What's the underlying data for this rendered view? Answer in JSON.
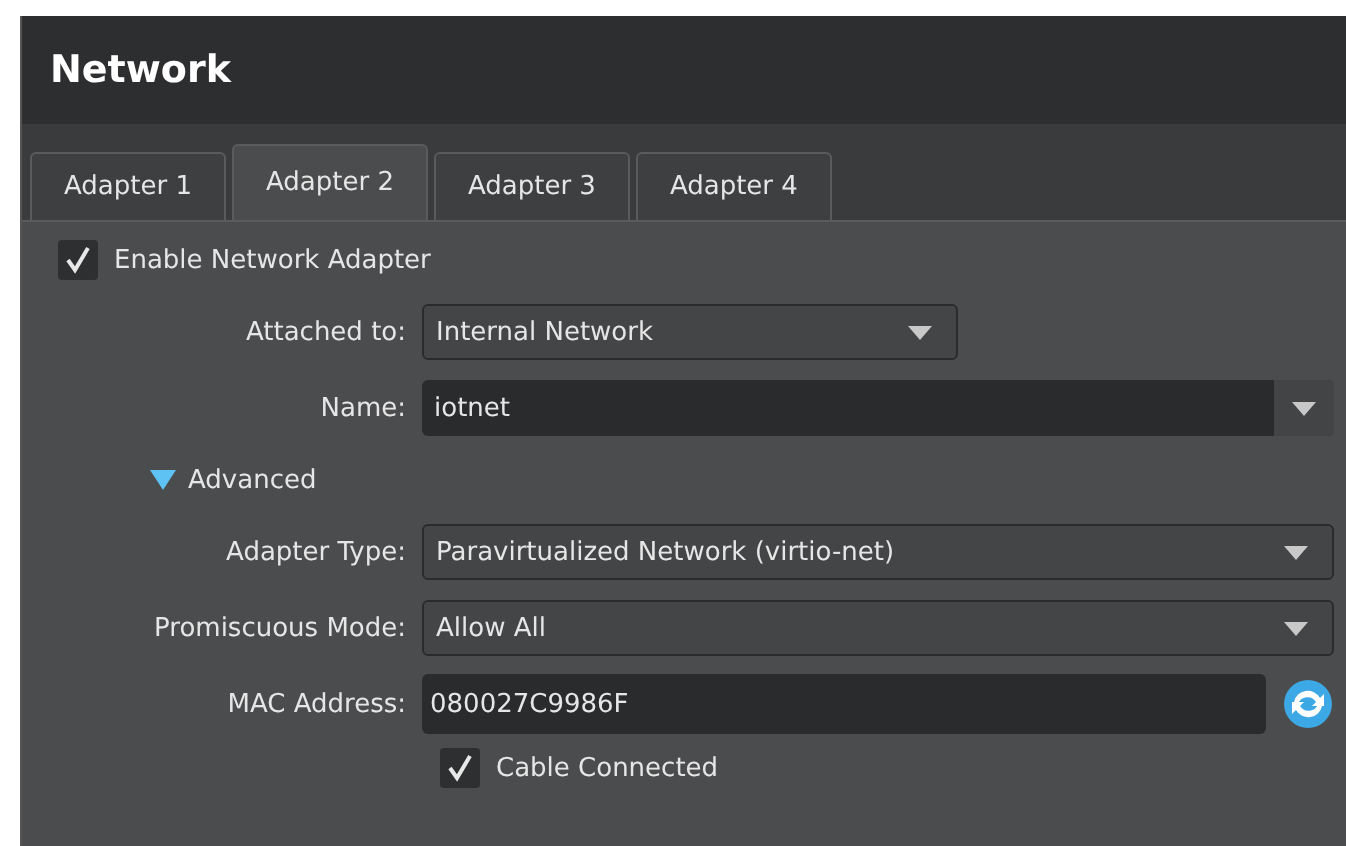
{
  "window": {
    "title": "Network"
  },
  "tabs": [
    {
      "label": "Adapter 1",
      "selected": false
    },
    {
      "label": "Adapter 2",
      "selected": true
    },
    {
      "label": "Adapter 3",
      "selected": false
    },
    {
      "label": "Adapter 4",
      "selected": false
    }
  ],
  "enable_adapter": {
    "label": "Enable Network Adapter",
    "checked": true
  },
  "attached_to": {
    "label": "Attached to:",
    "value": "Internal Network"
  },
  "name": {
    "label": "Name:",
    "value": "iotnet"
  },
  "advanced": {
    "label": "Advanced",
    "expanded": true
  },
  "adapter_type": {
    "label": "Adapter Type:",
    "value": "Paravirtualized Network (virtio-net)"
  },
  "promiscuous_mode": {
    "label": "Promiscuous Mode:",
    "value": "Allow All"
  },
  "mac_address": {
    "label": "MAC Address:",
    "value": "080027C9986F"
  },
  "cable_connected": {
    "label": "Cable Connected",
    "checked": true
  }
}
